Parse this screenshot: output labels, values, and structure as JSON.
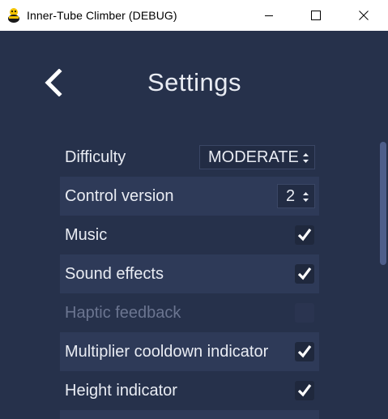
{
  "window": {
    "title": "Inner-Tube Climber (DEBUG)",
    "icon": "app-character-icon"
  },
  "header": {
    "back_icon": "back-chevron-icon",
    "title": "Settings"
  },
  "settings": {
    "difficulty": {
      "label": "Difficulty",
      "value": "MODERATE"
    },
    "control_version": {
      "label": "Control version",
      "value": "2"
    },
    "music": {
      "label": "Music",
      "checked": true
    },
    "sound_effects": {
      "label": "Sound effects",
      "checked": true
    },
    "haptic_feedback": {
      "label": "Haptic feedback",
      "checked": false,
      "disabled": true
    },
    "multiplier_indicator": {
      "label": "Multiplier cooldown indicator",
      "checked": true
    },
    "height_indicator": {
      "label": "Height indicator",
      "checked": true
    }
  },
  "colors": {
    "background": "#26314b",
    "row_alt": "#2e3a58",
    "text": "#e9ecf3",
    "disabled_text": "#6b7590",
    "scrollbar": "#4e5e8a"
  }
}
